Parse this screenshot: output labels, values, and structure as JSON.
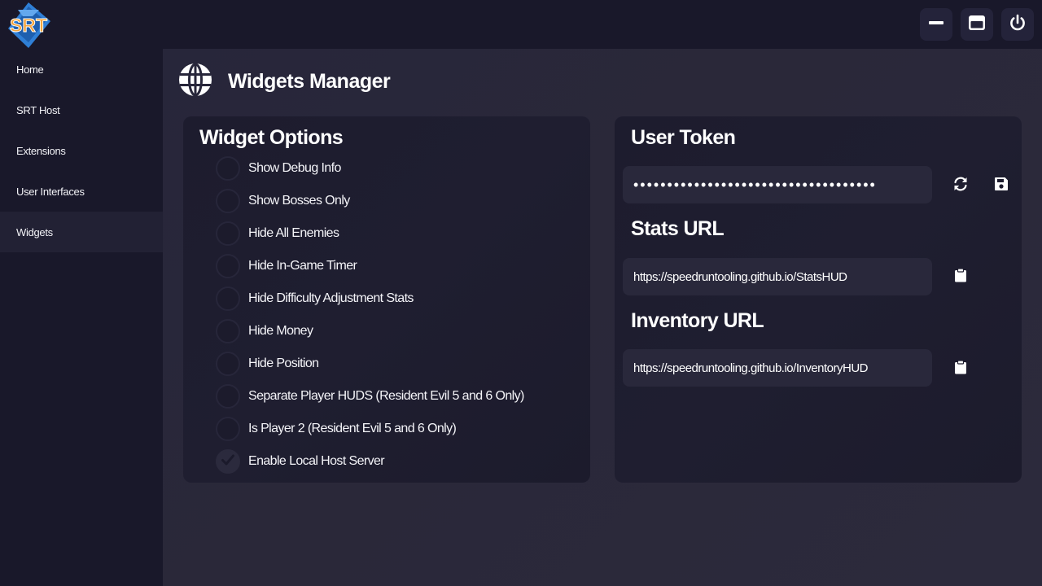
{
  "app": {
    "logo_text": "SRT"
  },
  "titlebar": {
    "buttons": [
      {
        "name": "minimize-button",
        "icon": "minimize-icon"
      },
      {
        "name": "maximize-button",
        "icon": "maximize-icon"
      },
      {
        "name": "power-button",
        "icon": "power-icon"
      }
    ]
  },
  "sidebar": {
    "items": [
      {
        "label": "Home",
        "active": false
      },
      {
        "label": "SRT Host",
        "active": false
      },
      {
        "label": "Extensions",
        "active": false
      },
      {
        "label": "User Interfaces",
        "active": false
      },
      {
        "label": "Widgets",
        "active": true
      }
    ]
  },
  "header": {
    "title": "Widgets Manager",
    "icon": "globe-icon"
  },
  "widget_options": {
    "title": "Widget Options",
    "options": [
      {
        "label": "Show Debug Info",
        "checked": false
      },
      {
        "label": "Show Bosses Only",
        "checked": false
      },
      {
        "label": "Hide All Enemies",
        "checked": false
      },
      {
        "label": "Hide In-Game Timer",
        "checked": false
      },
      {
        "label": "Hide Difficulty Adjustment Stats",
        "checked": false
      },
      {
        "label": "Hide Money",
        "checked": false
      },
      {
        "label": "Hide Position",
        "checked": false
      },
      {
        "label": "Separate Player HUDS (Resident Evil 5 and 6 Only)",
        "checked": false
      },
      {
        "label": "Is Player 2 (Resident Evil 5 and 6 Only)",
        "checked": false
      },
      {
        "label": "Enable Local Host Server",
        "checked": true
      }
    ]
  },
  "user_token": {
    "title": "User Token",
    "value": "••••••••••••••••••••••••••••••••••••",
    "refresh_icon": "refresh-icon",
    "save_icon": "save-icon"
  },
  "stats_url": {
    "title": "Stats URL",
    "value": "https://speedruntooling.github.io/StatsHUD",
    "copy_icon": "clipboard-icon"
  },
  "inventory_url": {
    "title": "Inventory URL",
    "value": "https://speedruntooling.github.io/InventoryHUD",
    "copy_icon": "clipboard-icon"
  },
  "colors": {
    "background": "#1b1a2b",
    "panel": "#1d1c2e",
    "field": "#29283b",
    "text": "#ffffff",
    "logo_blue": "#2f7fd6",
    "logo_orange": "#f3a43c"
  }
}
